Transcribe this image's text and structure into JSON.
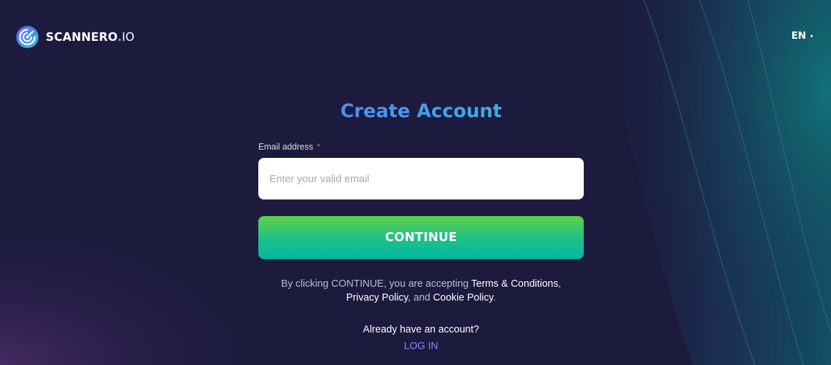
{
  "brand": {
    "name": "SCANNERO",
    "dot": ".",
    "suffix": "IO",
    "icon": "radar-gauge-icon",
    "accent_color": "#22c7e0"
  },
  "header": {
    "language": "EN",
    "language_caret": "▾"
  },
  "form": {
    "title": "Create Account",
    "email_label": "Email address",
    "required_mark": "*",
    "email_placeholder": "Enter your valid email",
    "email_value": "",
    "submit_label": "CONTINUE"
  },
  "legal": {
    "prefix": "By clicking CONTINUE, you are accepting ",
    "terms": "Terms & Conditions",
    "sep1": ",",
    "privacy": "Privacy Policy",
    "sep2": ", and ",
    "cookie": "Cookie Policy",
    "end": "."
  },
  "account": {
    "question": "Already have an account?",
    "login_label": "LOG IN"
  },
  "colors": {
    "background": "#1b1b3f",
    "title_gradient_start": "#5a79f4",
    "title_gradient_end": "#2dc3e6",
    "button_gradient_top": "#5ed14a",
    "button_gradient_bottom": "#04b7a4",
    "login_link": "#8c84ff"
  }
}
